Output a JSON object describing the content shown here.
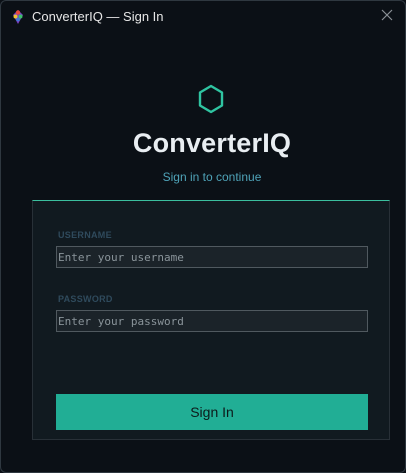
{
  "window": {
    "title": "ConverterIQ — Sign In",
    "close_icon": "close-icon",
    "app_icon": "app-logo-icon"
  },
  "branding": {
    "logo_icon": "hexagon-icon",
    "app_name": "ConverterIQ",
    "tagline": "Sign in to continue"
  },
  "form": {
    "username": {
      "label": "USERNAME",
      "placeholder": "Enter your username",
      "value": ""
    },
    "password": {
      "label": "PASSWORD",
      "placeholder": "Enter your password",
      "value": ""
    },
    "submit_label": "Sign In"
  },
  "colors": {
    "accent": "#21ae95",
    "background": "#0b1016",
    "card": "#111a20",
    "tagline": "#4fa3b8"
  }
}
